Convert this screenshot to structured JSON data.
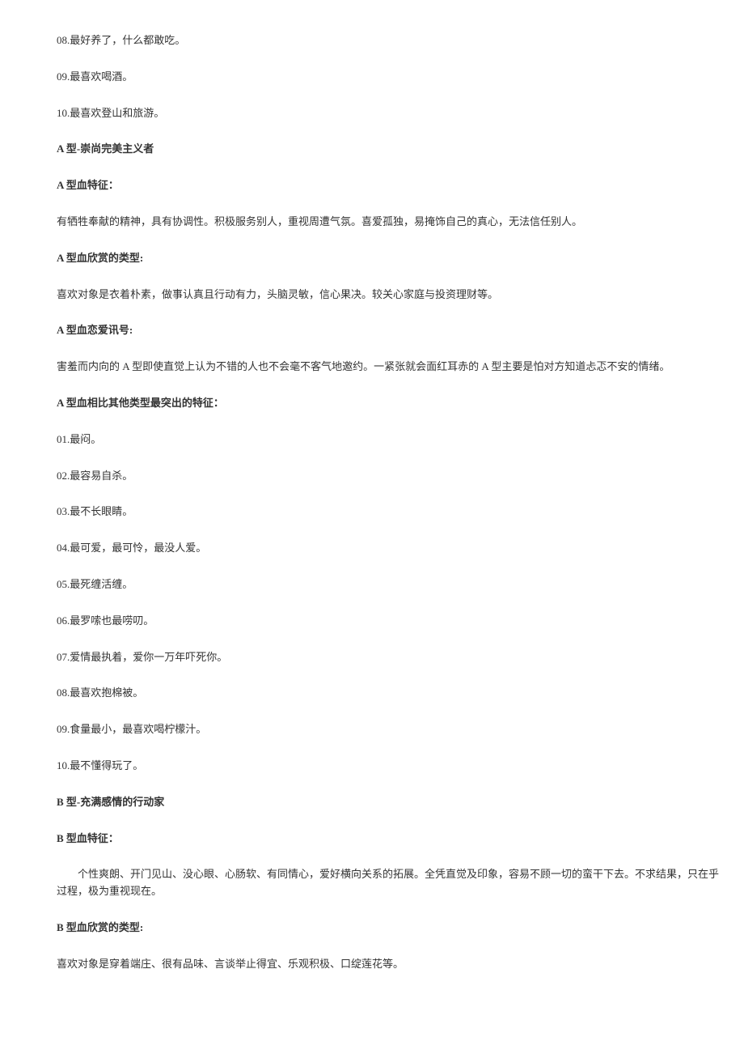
{
  "items": [
    {
      "text": "08.最好养了，什么都敢吃。",
      "bold": false,
      "indent": false
    },
    {
      "text": "09.最喜欢喝酒。",
      "bold": false,
      "indent": false
    },
    {
      "text": "10.最喜欢登山和旅游。",
      "bold": false,
      "indent": false
    },
    {
      "text": "A 型-崇尚完美主义者",
      "bold": true,
      "indent": false
    },
    {
      "text": "A 型血特征：",
      "bold": true,
      "indent": false
    },
    {
      "text": "有牺牲奉献的精神，具有协调性。积极服务别人，重视周遭气氛。喜爱孤独，易掩饰自己的真心，无法信任别人。",
      "bold": false,
      "indent": false
    },
    {
      "text": "A 型血欣赏的类型:",
      "bold": true,
      "indent": false
    },
    {
      "text": "喜欢对象是衣着朴素，做事认真且行动有力，头脑灵敏，信心果决。较关心家庭与投资理财等。",
      "bold": false,
      "indent": false
    },
    {
      "text": "A 型血恋爱讯号:",
      "bold": true,
      "indent": false
    },
    {
      "text": "害羞而内向的 A 型即使直觉上认为不错的人也不会毫不客气地邀约。一紧张就会面红耳赤的 A 型主要是怕对方知道忐忑不安的情绪。",
      "bold": false,
      "indent": false
    },
    {
      "text": "A 型血相比其他类型最突出的特征：",
      "bold": true,
      "indent": false
    },
    {
      "text": "01.最闷。",
      "bold": false,
      "indent": false
    },
    {
      "text": "02.最容易自杀。",
      "bold": false,
      "indent": false
    },
    {
      "text": "03.最不长眼睛。",
      "bold": false,
      "indent": false
    },
    {
      "text": "04.最可爱，最可怜，最没人爱。",
      "bold": false,
      "indent": false
    },
    {
      "text": "05.最死缠活缠。",
      "bold": false,
      "indent": false
    },
    {
      "text": "06.最罗嗦也最唠叨。",
      "bold": false,
      "indent": false
    },
    {
      "text": "07.爱情最执着，爱你一万年吓死你。",
      "bold": false,
      "indent": false
    },
    {
      "text": "08.最喜欢抱棉被。",
      "bold": false,
      "indent": false
    },
    {
      "text": "09.食量最小，最喜欢喝柠檬汁。",
      "bold": false,
      "indent": false
    },
    {
      "text": "10.最不懂得玩了。",
      "bold": false,
      "indent": false
    },
    {
      "text": "B 型-充满感情的行动家",
      "bold": true,
      "indent": false
    },
    {
      "text": "B 型血特征：",
      "bold": true,
      "indent": false
    },
    {
      "text": "个性爽朗、开门见山、没心眼、心肠软、有同情心，爱好横向关系的拓展。全凭直觉及印象，容易不顾一切的蛮干下去。不求结果，只在乎过程，极为重视现在。",
      "bold": false,
      "indent": true
    },
    {
      "text": "B 型血欣赏的类型:",
      "bold": true,
      "indent": false
    },
    {
      "text": "喜欢对象是穿着端庄、很有品味、言谈举止得宜、乐观积极、口绽莲花等。",
      "bold": false,
      "indent": false
    }
  ]
}
